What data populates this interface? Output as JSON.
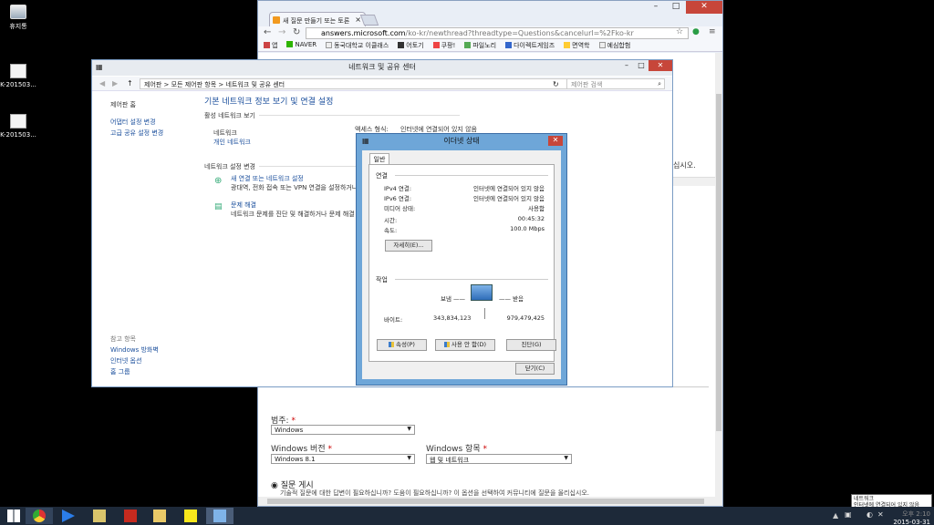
{
  "desktop": {
    "icons": [
      {
        "label": "휴지통"
      },
      {
        "label": "K-201503..."
      },
      {
        "label": "K-201503..."
      }
    ]
  },
  "browser": {
    "tab_title": "새 질문 만들기 또는 토론",
    "url_host": "answers.microsoft.com",
    "url_rest": "/ko-kr/newthread?threadtype=Questions&cancelurl=%2Fko-kr",
    "bookmarks": [
      "앱",
      "NAVER",
      "동국대학교 이클래스",
      "어토기",
      "쿠팡!",
      "파일노리",
      "다이렉트게임즈",
      "면역학",
      "예심합험"
    ],
    "page": {
      "snippet": "십시오.",
      "category_label": "범주:",
      "category_value": "Windows",
      "version_label": "Windows 버전",
      "version_value": "Windows 8.1",
      "topic_label": "Windows 항목",
      "topic_value": "웹 및 네트워크",
      "post_question": "질문 게시",
      "post_desc": "기술적 질문에 대한 답변이 필요하십니까? 도움이 필요하십니까? 이 옵션을 선택하여 커뮤니티에 질문을 올리십시오."
    }
  },
  "netcenter": {
    "title": "네트워크 및 공유 센터",
    "breadcrumb": "제어판  >  모든 제어판 항목  >  네트워크 및 공유 센터",
    "search_placeholder": "제어판 검색",
    "side": {
      "home": "제어판 홈",
      "adapter": "어댑터 설정 변경",
      "advanced": "고급 공유 설정 변경",
      "see_also": "참고 항목",
      "firewall": "Windows 방화벽",
      "internet": "인터넷 옵션",
      "homegroup": "홈 그룹"
    },
    "heading": "기본 네트워크 정보 보기 및 연결 설정",
    "active_section": "활성 네트워크 보기",
    "network_name": "네트워크",
    "network_type": "개인 네트워크",
    "access_label": "액세스 형식:",
    "access_value": "인터넷에 연결되어 있지 않음",
    "change_section": "네트워크 설정 변경",
    "new_conn_title": "새 연결 또는 네트워크 설정",
    "new_conn_desc": "광대역, 전화 접속 또는 VPN 연결을 설정하거나",
    "trouble_title": "문제 해결",
    "trouble_desc": "네트워크 문제를 진단 및 해결하거나 문제 해결 정"
  },
  "dialog": {
    "title": "이더넷 상태",
    "tab": "일반",
    "conn_group": "연결",
    "rows": [
      {
        "label": "IPv4 연결:",
        "value": "인터넷에 연결되어 있지 않음"
      },
      {
        "label": "IPv6 연결:",
        "value": "인터넷에 연결되어 있지 않음"
      },
      {
        "label": "미디어 상태:",
        "value": "사용함"
      },
      {
        "label": "시간:",
        "value": "00:45:32"
      },
      {
        "label": "속도:",
        "value": "100.0 Mbps"
      }
    ],
    "details_btn": "자세히(E)...",
    "activity_group": "작업",
    "sent_label": "보냄",
    "recv_label": "받음",
    "bytes_label": "바이트:",
    "bytes_sent": "343,834,123",
    "bytes_recv": "979,479,425",
    "props_btn": "속성(P)",
    "disable_btn": "사용 안 함(D)",
    "diag_btn": "진단(G)",
    "close_btn": "닫기(C)"
  },
  "taskbar": {
    "tooltip_title": "네트워크",
    "tooltip_text": "인터넷에 연결되어 있지 않음",
    "time": "오후 2:10",
    "date": "2015-03-31"
  }
}
